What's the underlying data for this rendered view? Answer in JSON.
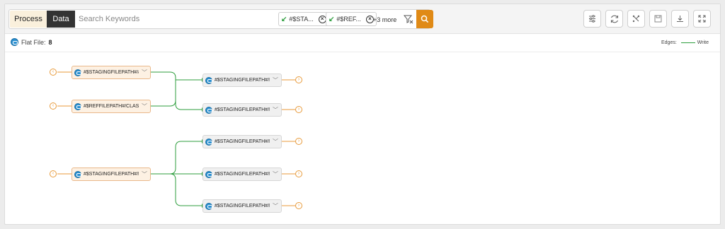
{
  "toolbar": {
    "tabs": [
      {
        "label": "Process"
      },
      {
        "label": "Data"
      }
    ],
    "search_placeholder": "Search Keywords",
    "chips": [
      {
        "label": "#$STA..."
      },
      {
        "label": "#$REF..."
      }
    ],
    "more_label": "+3 more",
    "icons": [
      "filter-settings-icon",
      "refresh-icon",
      "layout-icon",
      "save-icon",
      "download-icon",
      "fullscreen-icon"
    ],
    "accent": "#e08a16"
  },
  "summary": {
    "label": "Flat File:",
    "value": "8"
  },
  "legend": {
    "label": "Edges:",
    "item": "Write",
    "color": "#2e9e3e"
  },
  "graph": {
    "sources": [
      {
        "label": "#$STAGINGFILEPATH#/#..."
      },
      {
        "label": "#$REFFILEPATH#/CLASS..."
      },
      {
        "label": "#$STAGINGFILEPATH#/B..."
      }
    ],
    "targets": [
      {
        "label": "#$STAGINGFILEPATH#/I..."
      },
      {
        "label": "#$STAGINGFILEPATH#/D..."
      },
      {
        "label": "#$STAGINGFILEPATH#/E..."
      },
      {
        "label": "#$STAGINGFILEPATH#/E..."
      },
      {
        "label": "#$STAGINGFILEPATH#/E..."
      }
    ]
  }
}
